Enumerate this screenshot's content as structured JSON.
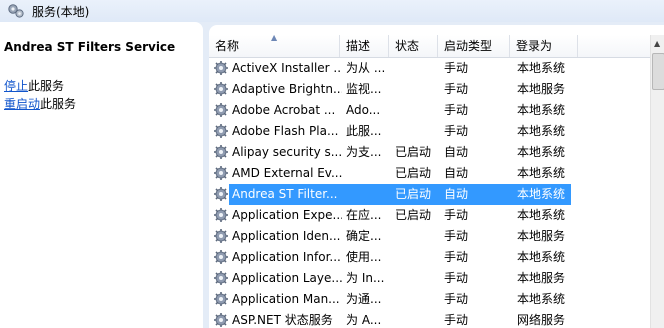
{
  "window": {
    "title": "服务(本地)"
  },
  "details": {
    "service_name": "Andrea ST Filters Service",
    "stop_link": "停止",
    "stop_suffix": "此服务",
    "restart_link": "重启动",
    "restart_suffix": "此服务"
  },
  "columns": {
    "name": "名称",
    "desc": "描述",
    "status": "状态",
    "startup": "启动类型",
    "logon": "登录为"
  },
  "services": [
    {
      "name": "ActiveX Installer ...",
      "desc": "为从 ...",
      "status": "",
      "startup": "手动",
      "logon": "本地系统"
    },
    {
      "name": "Adaptive Brightn...",
      "desc": "监视...",
      "status": "",
      "startup": "手动",
      "logon": "本地服务"
    },
    {
      "name": "Adobe Acrobat ...",
      "desc": "Ado...",
      "status": "",
      "startup": "手动",
      "logon": "本地系统"
    },
    {
      "name": "Adobe Flash Pla...",
      "desc": "此服...",
      "status": "",
      "startup": "手动",
      "logon": "本地系统"
    },
    {
      "name": "Alipay security s...",
      "desc": "为支...",
      "status": "已启动",
      "startup": "自动",
      "logon": "本地系统"
    },
    {
      "name": "AMD External Ev...",
      "desc": "",
      "status": "已启动",
      "startup": "自动",
      "logon": "本地系统"
    },
    {
      "name": "Andrea ST Filter...",
      "desc": "",
      "status": "已启动",
      "startup": "自动",
      "logon": "本地系统",
      "selected": true
    },
    {
      "name": "Application Expe...",
      "desc": "在应...",
      "status": "已启动",
      "startup": "手动",
      "logon": "本地系统"
    },
    {
      "name": "Application Iden...",
      "desc": "确定...",
      "status": "",
      "startup": "手动",
      "logon": "本地服务"
    },
    {
      "name": "Application Infor...",
      "desc": "使用...",
      "status": "",
      "startup": "手动",
      "logon": "本地系统"
    },
    {
      "name": "Application Laye...",
      "desc": "为 In...",
      "status": "",
      "startup": "手动",
      "logon": "本地服务"
    },
    {
      "name": "Application Man...",
      "desc": "为通...",
      "status": "",
      "startup": "手动",
      "logon": "本地系统"
    },
    {
      "name": "ASP.NET 状态服务",
      "desc": "为 A...",
      "status": "",
      "startup": "手动",
      "logon": "网络服务"
    }
  ],
  "icons": {
    "header": "services-gears-icon",
    "row": "service-gear-icon"
  }
}
